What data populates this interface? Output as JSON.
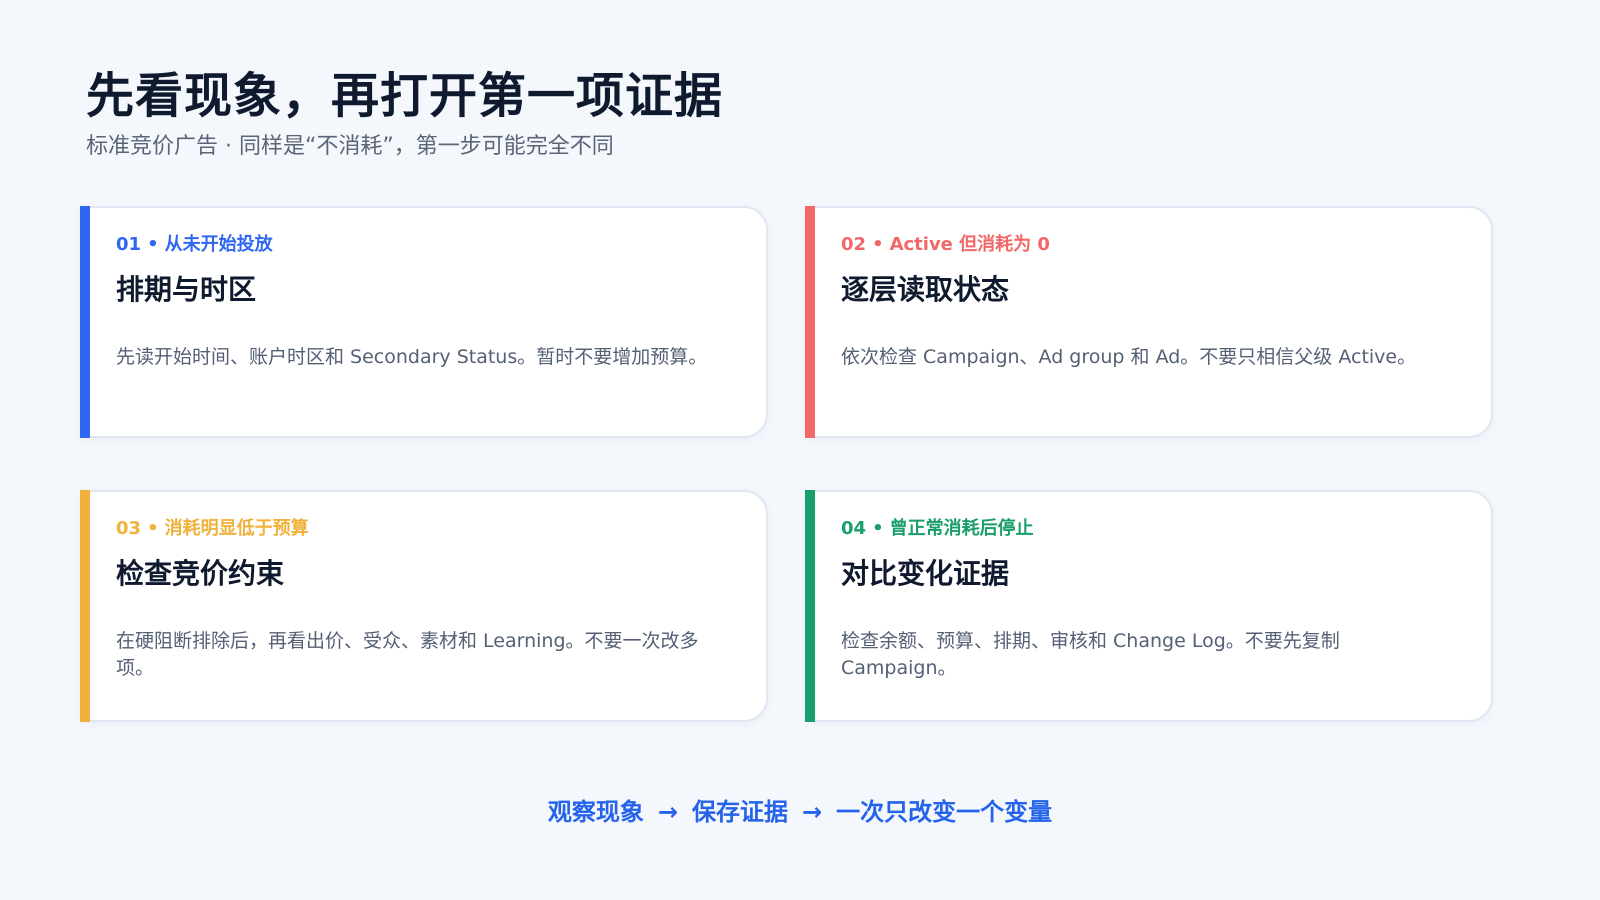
{
  "header": {
    "title": "先看现象，再打开第一项证据",
    "subtitle": "标准竞价广告 · 同样是“不消耗”，第一步可能完全不同"
  },
  "cards": [
    {
      "number": "01",
      "tag": "从未开始投放",
      "heading": "排期与时区",
      "body": "先读开始时间、账户时区和 Secondary Status。暂时不要增加预算。",
      "color": "#2f66f2"
    },
    {
      "number": "02",
      "tag": "Active 但消耗为 0",
      "heading": "逐层读取状态",
      "body": "依次检查 Campaign、Ad group 和 Ad。不要只相信父级 Active。",
      "color": "#f26868"
    },
    {
      "number": "03",
      "tag": "消耗明显低于预算",
      "heading": "检查竞价约束",
      "body": "在硬阻断排除后，再看出价、受众、素材和 Learning。不要一次改多项。",
      "color": "#f0b23a"
    },
    {
      "number": "04",
      "tag": "曾正常消耗后停止",
      "heading": "对比变化证据",
      "body": "检查余额、预算、排期、审核和 Change Log。不要先复制 Campaign。",
      "color": "#1a9e6b"
    }
  ],
  "footer": {
    "step1": "观察现象",
    "step2": "保存证据",
    "step3": "一次只改变一个变量",
    "arrow": "→"
  }
}
